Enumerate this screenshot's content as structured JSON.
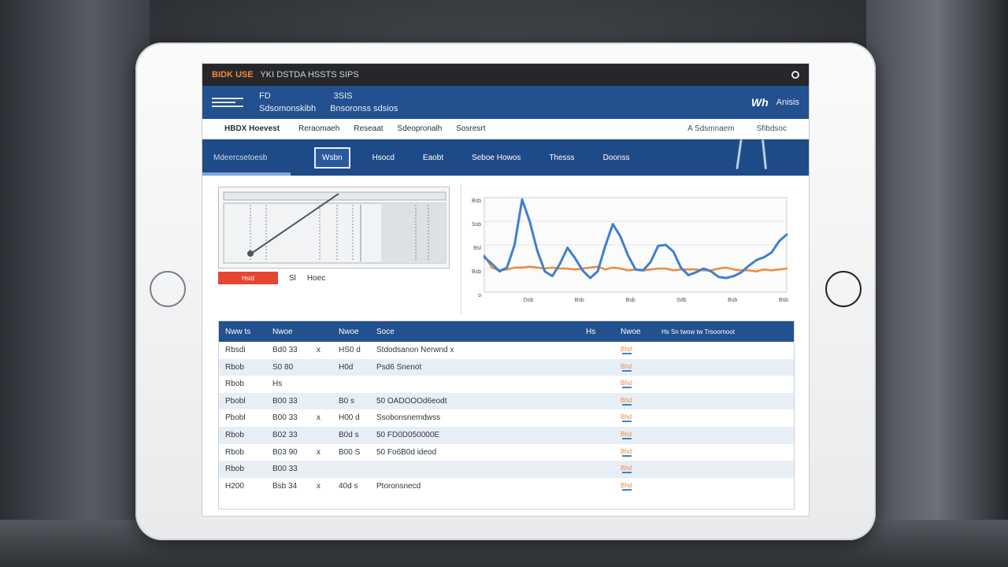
{
  "statusbar": {
    "brand": "BIDK USE",
    "text": "YKI DSTDA HSSTS SIPS",
    "right_icon": "power-icon"
  },
  "appbar": {
    "line1": "FD",
    "line2": "Sdsomonskibh",
    "line3": "Bnsoronss sdsios",
    "line4": "3SIS",
    "logo": "Wh",
    "right_label": "Anisis"
  },
  "subnav": {
    "brand": "HBDX Hoevest",
    "items": [
      "Reraomaeh",
      "Reseaat",
      "Sdeopronalh",
      "Sosresrt"
    ],
    "right": [
      "A Sdsmnaem",
      "Sfibdsoc"
    ]
  },
  "tabbar": {
    "section": "Mdeercsetoesb",
    "tabs": [
      "Wsbn",
      "Hsocd",
      "Eaobt",
      "Seboe Howos",
      "Thesss",
      "Doonss"
    ]
  },
  "left_panel": {
    "button": "Hsid",
    "mid": "Sl",
    "right": "Hoec"
  },
  "colors": {
    "accent": "#23508f",
    "series_a": "#3f7fd0",
    "series_b": "#ef8a3c",
    "alert": "#e64530"
  },
  "chart_data": {
    "type": "line",
    "title": "",
    "xlabel": "",
    "ylabel": "",
    "y_ticks": [
      "Bsb",
      "Ssb",
      "Bsl",
      "Bsb",
      "o"
    ],
    "x_ticks": [
      "Dsb",
      "Bsb",
      "Bsb",
      "Sdb",
      "Bsb",
      "Bsb"
    ],
    "x": [
      0,
      1,
      2,
      3,
      4,
      5,
      6,
      7,
      8,
      9,
      10,
      11,
      12,
      13,
      14,
      15,
      16,
      17,
      18,
      19,
      20,
      21,
      22,
      23,
      24,
      25,
      26,
      27,
      28,
      29,
      30,
      31,
      32,
      33,
      34,
      35,
      36,
      37,
      38,
      39,
      40
    ],
    "ylim": [
      0,
      10
    ],
    "series": [
      {
        "values": [
          3.7,
          3.0,
          2.2,
          2.6,
          5.0,
          9.8,
          7.5,
          4.4,
          2.2,
          1.7,
          3.0,
          4.7,
          3.6,
          2.3,
          1.5,
          2.2,
          4.9,
          7.2,
          5.9,
          3.9,
          2.4,
          2.3,
          3.2,
          4.9,
          5.0,
          4.3,
          2.6,
          1.8,
          2.1,
          2.5,
          2.2,
          1.6,
          1.5,
          1.7,
          2.1,
          2.8,
          3.4,
          3.7,
          4.2,
          5.4,
          6.1
        ]
      },
      {
        "values": [
          3.9,
          2.6,
          2.3,
          2.4,
          2.6,
          2.6,
          2.7,
          2.6,
          2.5,
          2.6,
          2.5,
          2.5,
          2.4,
          2.5,
          2.6,
          2.7,
          2.4,
          2.6,
          2.5,
          2.3,
          2.4,
          2.3,
          2.4,
          2.5,
          2.5,
          2.3,
          2.4,
          2.4,
          2.4,
          2.3,
          2.3,
          2.5,
          2.6,
          2.4,
          2.3,
          2.3,
          2.2,
          2.4,
          2.3,
          2.4,
          2.5
        ]
      }
    ]
  },
  "table": {
    "headers": [
      "Nww  ts",
      "Nwoe",
      "Nwoe",
      "Soce",
      "Hs",
      "Nwoe",
      "Hs  Sn  twow  tw  Trsoornoot"
    ],
    "rows": [
      {
        "c1": "Rbsdi",
        "c2": "Bd0  33",
        "c3": "x",
        "c4": "HS0  d",
        "c5": "Stdodsanon Nerwnd  x",
        "tag": "Bhd"
      },
      {
        "c1": "Rbob",
        "c2": "S0  80",
        "c3": "",
        "c4": "H0d",
        "c5": "Psd6 Snenot",
        "tag": "Bhd"
      },
      {
        "c1": "Rbob",
        "c2": "Hs",
        "c3": "",
        "c4": "",
        "c5": "",
        "tag": "Bhd"
      },
      {
        "c1": "Pbobl",
        "c2": "B00  33",
        "c3": "",
        "c4": "B0  s",
        "c5": "50  OADOOOd6eodt",
        "tag": "Bhd"
      },
      {
        "c1": "Pbobl",
        "c2": "B00  33",
        "c3": "x",
        "c4": "H00  d",
        "c5": "Ssobonsnemdwss",
        "tag": "Bhd"
      },
      {
        "c1": "Rbob",
        "c2": "B02  33",
        "c3": "",
        "c4": "B0d  s",
        "c5": "50 FD0D050000E",
        "tag": "Bhd"
      },
      {
        "c1": "Rbob",
        "c2": "B03  90",
        "c3": "x",
        "c4": "B00  S",
        "c5": "50 Fo6B0d  ideod",
        "tag": "Bhd"
      },
      {
        "c1": "Rbob",
        "c2": "B00  33",
        "c3": "",
        "c4": "",
        "c5": "",
        "tag": "Bhd"
      },
      {
        "c1": "H200",
        "c2": "Bsb  34",
        "c3": "x",
        "c4": "40d  s",
        "c5": "Ptoronsnecd",
        "tag": "Bhd"
      }
    ]
  }
}
